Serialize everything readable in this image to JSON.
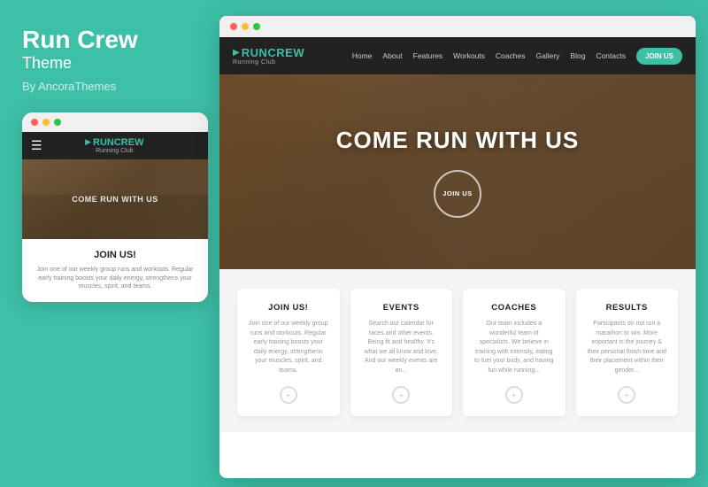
{
  "left": {
    "brand": {
      "title": "Run Crew",
      "subtitle": "Theme",
      "by": "By AncoraThemes"
    },
    "mobile": {
      "nav": {
        "logoArrow": "▶",
        "logoText": "RUNCREW",
        "logoSub": "Running Club"
      },
      "hero": {
        "text": "COME RUN WITH US"
      },
      "joinSection": {
        "title": "JOIN US!",
        "text": "Join one of our weekly group runs and workouts. Regular early training boosts your daily energy, strengthens your muscles, spirit, and teams."
      }
    }
  },
  "browser": {
    "nav": {
      "logoArrow": "▶",
      "logoText": "RUNCREW",
      "logoSub": "Running Club",
      "links": [
        "Home",
        "About",
        "Features",
        "Workouts",
        "Coaches",
        "Gallery",
        "Blog",
        "Contacts"
      ],
      "joinBtn": "JOIN US"
    },
    "hero": {
      "title": "COME RUN WITH US",
      "joinBtn": "JOIN US"
    },
    "cards": [
      {
        "title": "JOIN US!",
        "text": "Join one of our weekly group runs and workouts. Regular early training boosts your daily energy, strengthens your muscles, spirit, and teams.",
        "icon": "+"
      },
      {
        "title": "EVENTS",
        "text": "Search our calendar for races and other events. Being fit and healthy. It's what we all know and love. And our weekly events are an...",
        "icon": "+"
      },
      {
        "title": "COACHES",
        "text": "Our team includes a wonderful team of specialists. We believe in training with intensity, eating to fuel your body, and having fun while running...",
        "icon": "+"
      },
      {
        "title": "RESULTS",
        "text": "Participants do not run a marathon to win. More important is the journey & their personal finish time and their placement within their gender...",
        "icon": "+"
      }
    ]
  }
}
